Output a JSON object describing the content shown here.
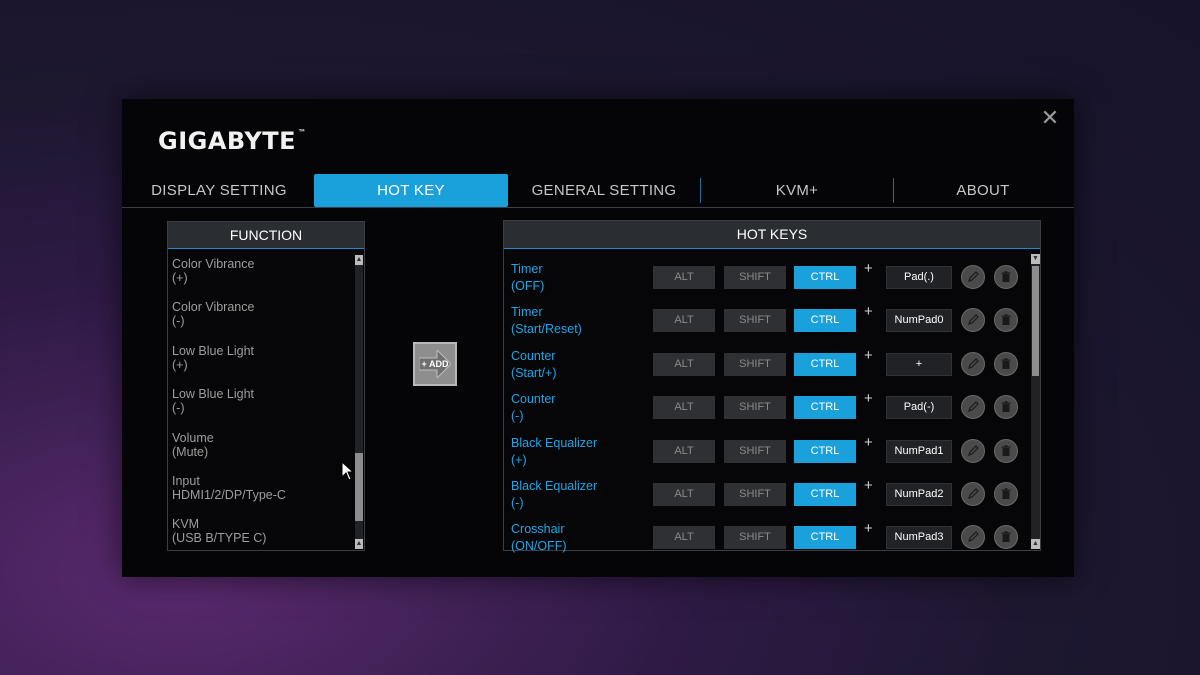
{
  "window": {
    "brand": "GIGABYTE",
    "trademark": "™",
    "close_symbol": "✕"
  },
  "tabs": [
    {
      "label": "DISPLAY SETTING",
      "active": false
    },
    {
      "label": "HOT KEY",
      "active": true
    },
    {
      "label": "GENERAL SETTING",
      "active": false
    },
    {
      "label": "KVM+",
      "active": false
    },
    {
      "label": "ABOUT",
      "active": false
    }
  ],
  "function_panel": {
    "header": "FUNCTION",
    "items": [
      {
        "line1": "Color Vibrance",
        "line2": "(+)"
      },
      {
        "line1": "Color Vibrance",
        "line2": "(-)"
      },
      {
        "line1": "Low Blue Light",
        "line2": "(+)"
      },
      {
        "line1": "Low Blue Light",
        "line2": "(-)"
      },
      {
        "line1": "Volume",
        "line2": "(Mute)"
      },
      {
        "line1": "Input",
        "line2": "HDMI1/2/DP/Type-C"
      },
      {
        "line1": "KVM",
        "line2": "(USB B/TYPE C)"
      }
    ]
  },
  "add_button": {
    "label": "+ ADD"
  },
  "hotkeys_panel": {
    "header": "HOT KEYS",
    "plus_symbol": "+",
    "rows": [
      {
        "line1": "Timer",
        "line2": "(OFF)",
        "alt": "ALT",
        "shift": "SHIFT",
        "ctrl": "CTRL",
        "key": "Pad(.)"
      },
      {
        "line1": "Timer",
        "line2": "(Start/Reset)",
        "alt": "ALT",
        "shift": "SHIFT",
        "ctrl": "CTRL",
        "key": "NumPad0"
      },
      {
        "line1": "Counter",
        "line2": "(Start/+)",
        "alt": "ALT",
        "shift": "SHIFT",
        "ctrl": "CTRL",
        "key": "+"
      },
      {
        "line1": "Counter",
        "line2": "(-)",
        "alt": "ALT",
        "shift": "SHIFT",
        "ctrl": "CTRL",
        "key": "Pad(-)"
      },
      {
        "line1": "Black Equalizer",
        "line2": "(+)",
        "alt": "ALT",
        "shift": "SHIFT",
        "ctrl": "CTRL",
        "key": "NumPad1"
      },
      {
        "line1": "Black Equalizer",
        "line2": "(-)",
        "alt": "ALT",
        "shift": "SHIFT",
        "ctrl": "CTRL",
        "key": "NumPad2"
      },
      {
        "line1": "Crosshair",
        "line2": "(ON/OFF)",
        "alt": "ALT",
        "shift": "SHIFT",
        "ctrl": "CTRL",
        "key": "NumPad3"
      }
    ]
  },
  "colors": {
    "accent": "#1aa0da",
    "hotkey_name": "#1ea6e6",
    "window_bg": "#050507"
  },
  "icons": {
    "close": "close-icon",
    "edit": "pencil-icon",
    "delete": "trash-icon",
    "add": "add-arrow-icon",
    "cursor": "mouse-cursor-icon"
  }
}
